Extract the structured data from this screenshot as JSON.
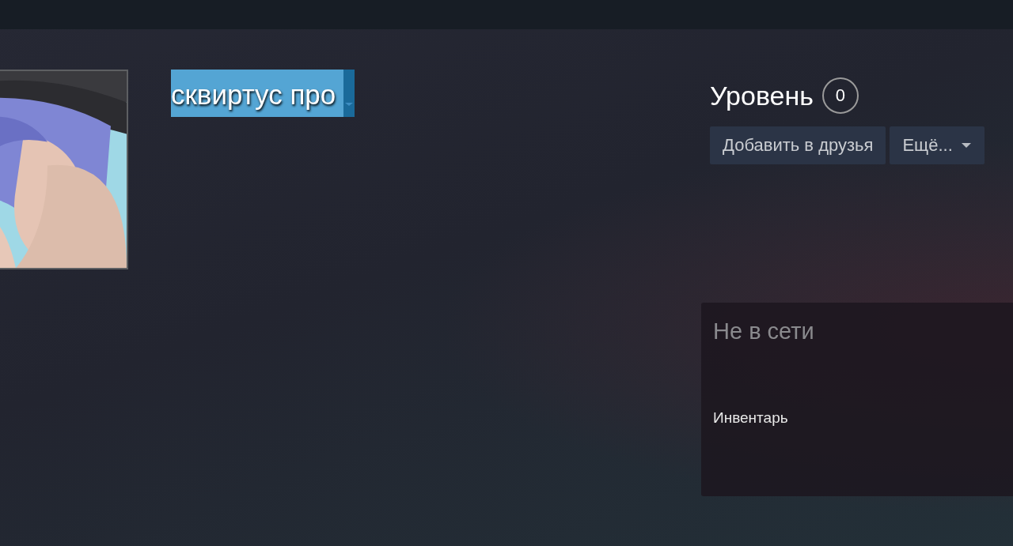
{
  "profile": {
    "name": "сквиртус про",
    "name_selected": true
  },
  "level": {
    "label": "Уровень",
    "value": "0"
  },
  "buttons": [
    {
      "label": "Добавить в друзья",
      "kind": "plain"
    },
    {
      "label": "Ещё...",
      "kind": "dropdown"
    }
  ],
  "status_panel": {
    "status": "Не в сети",
    "links": [
      "Инвентарь"
    ]
  }
}
